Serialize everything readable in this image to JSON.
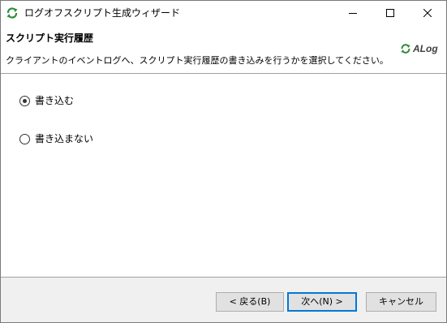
{
  "window": {
    "title": "ログオフスクリプト生成ウィザード",
    "app_icon": "refresh-arrows-icon",
    "controls": {
      "minimize_icon": "minimize-icon",
      "maximize_icon": "maximize-icon",
      "close_icon": "close-icon"
    }
  },
  "header": {
    "title": "スクリプト実行履歴",
    "description": "クライアントのイベントログへ、スクリプト実行履歴の書き込みを行うかを選択してください。",
    "logo_text": "ALog",
    "logo_icon": "alog-logo-icon"
  },
  "options": [
    {
      "label": "書き込む",
      "selected": true
    },
    {
      "label": "書き込まない",
      "selected": false
    }
  ],
  "footer": {
    "back_label": "< 戻る(B)",
    "next_label": "次へ(N) >",
    "cancel_label": "キャンセル"
  },
  "colors": {
    "accent": "#0078d7",
    "logo_green": "#2e8b3a",
    "button_bg": "#e1e1e1",
    "dialog_bg": "#f0f0f0"
  }
}
